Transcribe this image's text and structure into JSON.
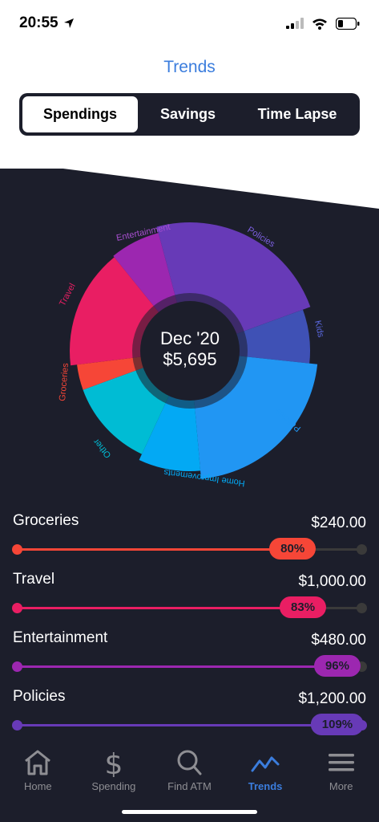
{
  "status": {
    "time": "20:55"
  },
  "header": {
    "title": "Trends"
  },
  "segments": [
    {
      "label": "Spendings",
      "active": true
    },
    {
      "label": "Savings",
      "active": false
    },
    {
      "label": "Time Lapse",
      "active": false
    }
  ],
  "donut": {
    "month": "Dec '20",
    "total": "$5,695",
    "labels": {
      "entertainment": "Entertainment",
      "policies_top": "Policies",
      "kids": "Kids",
      "policies_bottom": "Policies",
      "home_improvements": "Home Improvements",
      "other": "Other",
      "groceries": "Groceries",
      "travel": "Travel"
    }
  },
  "categories": [
    {
      "label": "Groceries",
      "amount": "$240.00",
      "percent": "80%",
      "progress": 0.8,
      "color": "#f64637"
    },
    {
      "label": "Travel",
      "amount": "$1,000.00",
      "percent": "83%",
      "progress": 0.83,
      "color": "#e91e63"
    },
    {
      "label": "Entertainment",
      "amount": "$480.00",
      "percent": "96%",
      "progress": 0.96,
      "color": "#9c27b0"
    },
    {
      "label": "Policies",
      "amount": "$1,200.00",
      "percent": "109%",
      "progress": 1.0,
      "color": "#673ab7"
    }
  ],
  "tabs": [
    {
      "label": "Home",
      "icon": "home-icon",
      "active": false
    },
    {
      "label": "Spending",
      "icon": "dollar-icon",
      "active": false
    },
    {
      "label": "Find ATM",
      "icon": "search-icon",
      "active": false
    },
    {
      "label": "Trends",
      "icon": "trends-icon",
      "active": true
    },
    {
      "label": "More",
      "icon": "menu-icon",
      "active": false
    }
  ]
}
